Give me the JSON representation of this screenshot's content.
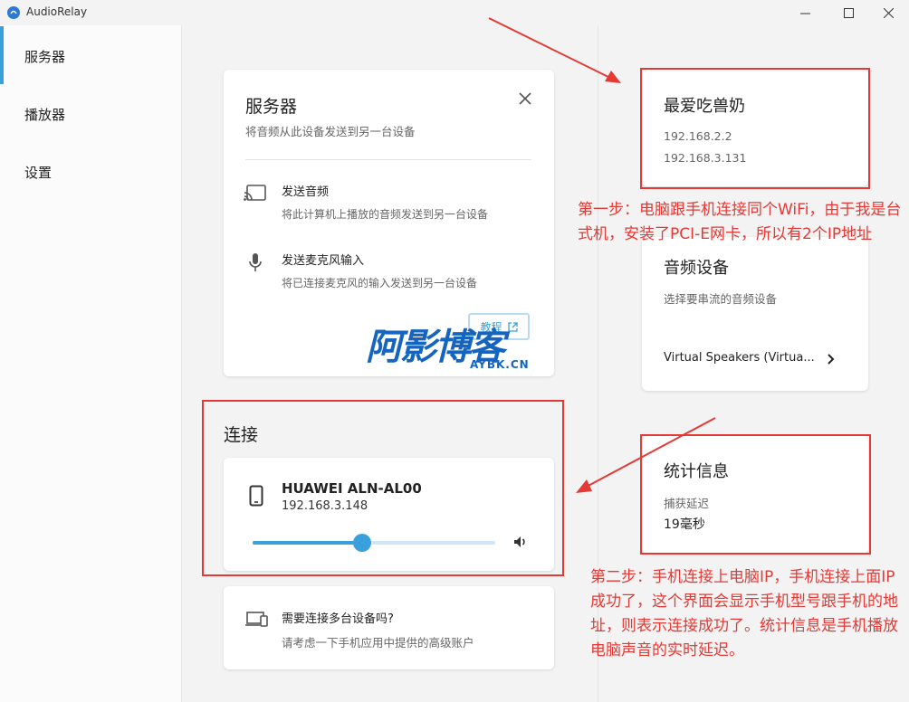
{
  "window": {
    "title": "AudioRelay"
  },
  "sidebar": {
    "items": [
      {
        "label": "服务器",
        "active": true
      },
      {
        "label": "播放器",
        "active": false
      },
      {
        "label": "设置",
        "active": false
      }
    ]
  },
  "server_card": {
    "title": "服务器",
    "subtitle": "将音频从此设备发送到另一台设备",
    "options": [
      {
        "title": "发送音频",
        "desc": "将此计算机上播放的音频发送到另一台设备",
        "icon": "cast-icon"
      },
      {
        "title": "发送麦克风输入",
        "desc": "将已连接麦克风的输入发送到另一台设备",
        "icon": "microphone-icon"
      }
    ],
    "tutorial_label": "教程"
  },
  "connection": {
    "heading": "连接",
    "device_name": "HUAWEI ALN-AL00",
    "device_ip": "192.168.3.148",
    "volume": 0.45
  },
  "multi_device": {
    "title": "需要连接多台设备吗?",
    "desc": "请考虑一下手机应用中提供的高级账户"
  },
  "computer_card": {
    "name": "最爱吃兽奶",
    "ips": [
      "192.168.2.2",
      "192.168.3.131"
    ]
  },
  "audio_device_card": {
    "title": "音频设备",
    "subtitle": "选择要串流的音频设备",
    "selected": "Virtual Speakers (Virtua..."
  },
  "stats_card": {
    "title": "统计信息",
    "latency_label": "捕获延迟",
    "latency_value": "19毫秒"
  },
  "annotations": {
    "step1": "第一步：电脑跟手机连接同个WiFi，由于我是台式机，安装了PCI-E网卡，所以有2个IP地址",
    "step2": "第二步：手机连接上电脑IP，手机连接上面IP成功了，这个界面会显示手机型号跟手机的地址，则表示连接成功了。统计信息是手机播放电脑声音的实时延迟。",
    "color": "#e53935"
  },
  "watermark": {
    "main": "阿影博客",
    "sub": "AYBK.CN"
  }
}
